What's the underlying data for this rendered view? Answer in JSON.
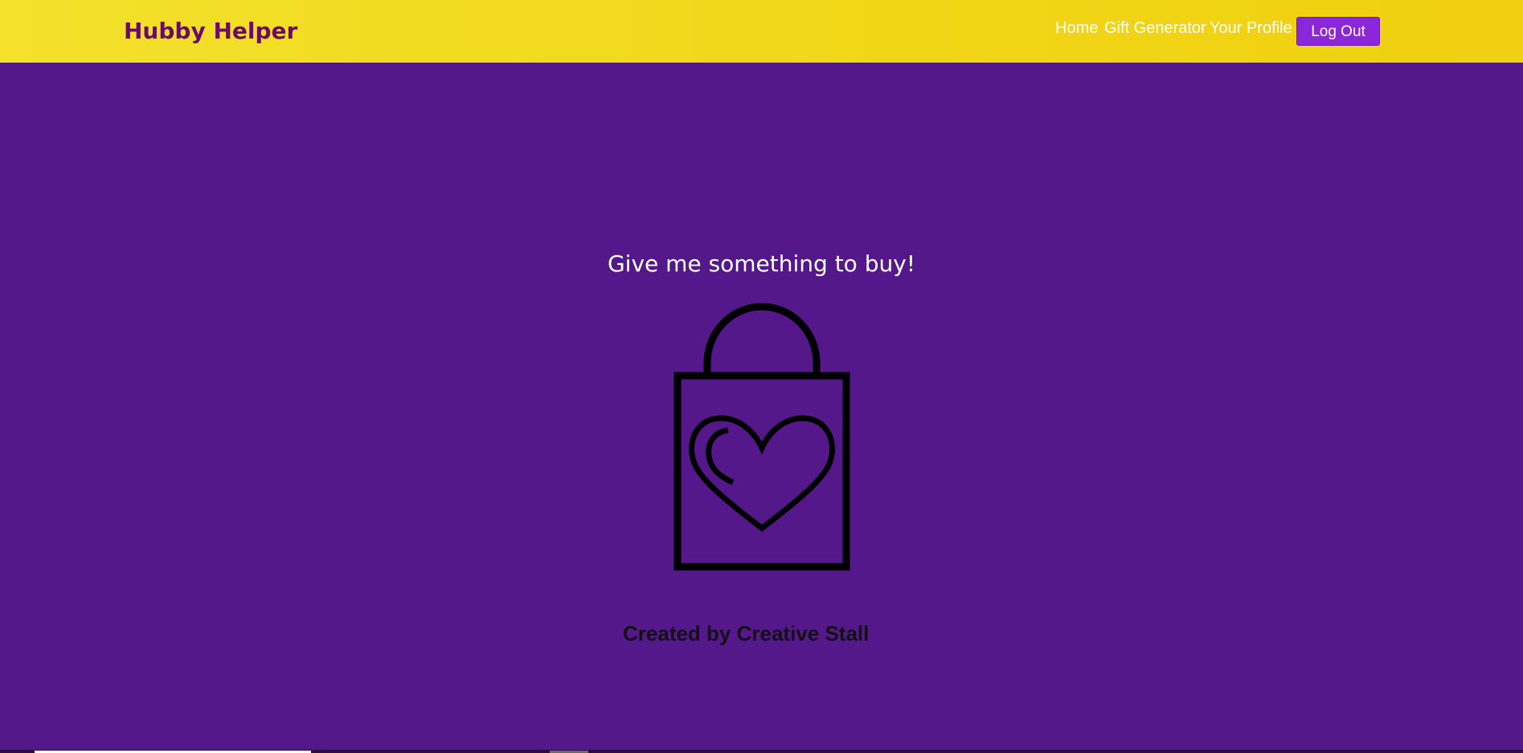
{
  "navbar": {
    "brand": "Hubby Helper",
    "links": [
      {
        "label": "Home"
      },
      {
        "label": "Gift Generator"
      },
      {
        "label": "Your Profile"
      }
    ],
    "logout_label": "Log Out"
  },
  "main": {
    "prompt": "Give me something to buy!",
    "icon": "shopping-bag-heart-icon",
    "credit": "Created by Creative Stall"
  },
  "colors": {
    "navbar_bg": "#f2dc20",
    "page_bg": "#55188a",
    "brand_text": "#6b0a6b",
    "button_bg": "#8b27d8"
  }
}
